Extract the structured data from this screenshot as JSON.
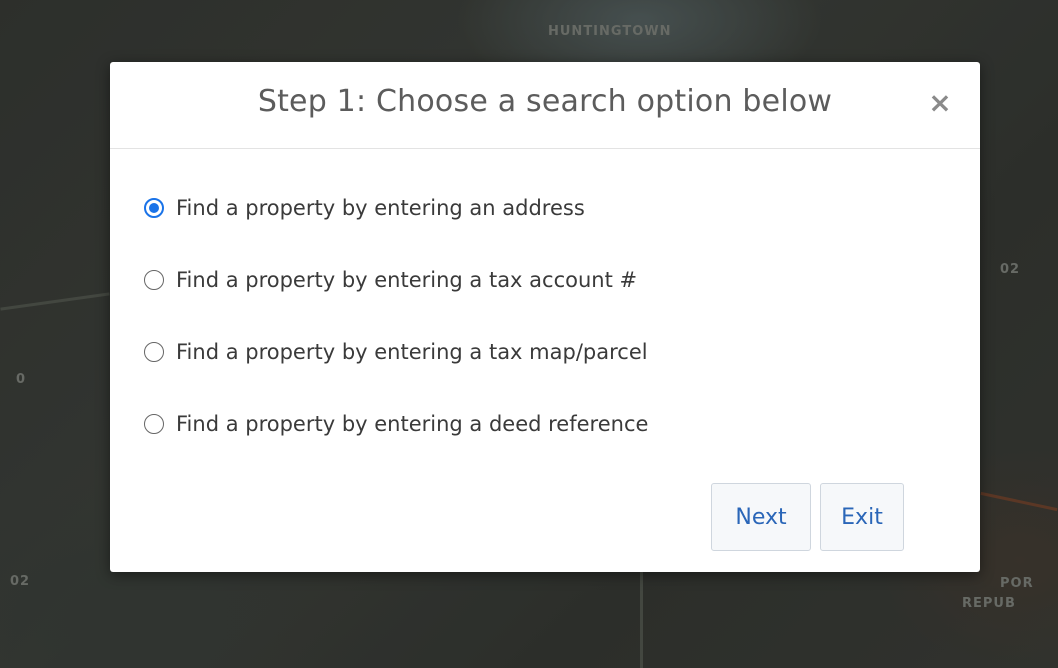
{
  "map": {
    "labels": [
      "HUNTINGTOWN",
      "02",
      "0",
      "02",
      "POR",
      "REPUB"
    ]
  },
  "dialog": {
    "title": "Step 1: Choose a search option below",
    "close_label": "×",
    "options": [
      {
        "label": "Find a property by entering an address",
        "selected": true
      },
      {
        "label": "Find a property by entering a tax account #",
        "selected": false
      },
      {
        "label": "Find a property by entering a tax map/parcel",
        "selected": false
      },
      {
        "label": "Find a property by entering a deed reference",
        "selected": false
      }
    ],
    "next_label": "Next",
    "exit_label": "Exit"
  },
  "colors": {
    "accent": "#1a73e8",
    "button_text": "#2a66b8"
  }
}
